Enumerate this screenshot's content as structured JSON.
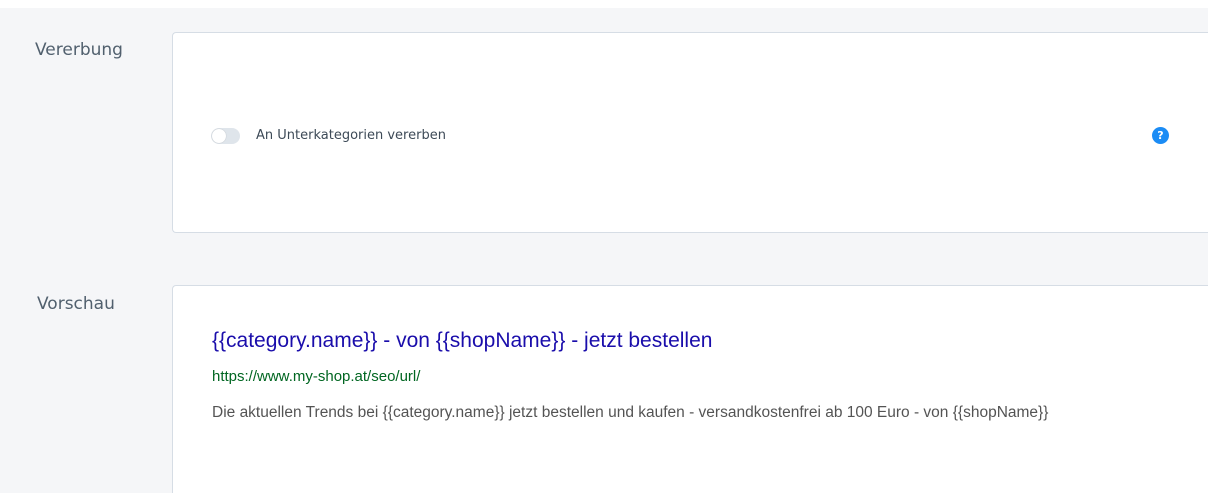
{
  "inheritance": {
    "section_label": "Vererbung",
    "toggle": {
      "label": "An Unterkategorien vererben",
      "checked": false
    },
    "help_icon": {
      "icon": "question-circle-icon",
      "glyph": "?",
      "color": "#1b8cf5"
    }
  },
  "preview": {
    "section_label": "Vorschau",
    "title": "{{category.name}} - von {{shopName}} - jetzt bestellen",
    "url": "https://www.my-shop.at/seo/url/",
    "description": "Die aktuellen Trends bei {{category.name}} jetzt bestellen und kaufen - versandkostenfrei ab 100 Euro - von {{shopName}}",
    "colors": {
      "title": "#1a0dab",
      "url": "#006621",
      "description": "#545454"
    }
  }
}
